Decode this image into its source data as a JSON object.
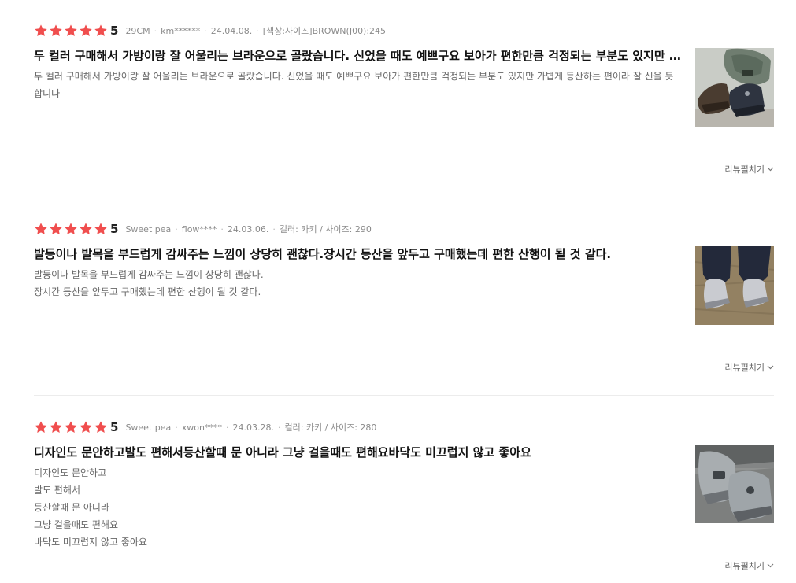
{
  "colors": {
    "star": "#f04e4e",
    "meta_text": "#8a8a8a",
    "title_text": "#111111",
    "body_text": "#666666",
    "divider": "#ececec"
  },
  "expand_icon": "chevron-down-icon",
  "reviews": [
    {
      "stars": 5,
      "rating": "5",
      "source": "29CM",
      "user": "km******",
      "date": "24.04.08.",
      "option": "[색상:사이즈]BROWN(J00):245",
      "title": "두 컬러 구매해서 가방이랑 잘 어울리는 브라운으로 골랐습니다. 신었을 때도 예쁘구요 보아가 편한만큼 걱정되는 부분도 있지만 가볍게 등산하는 편이라 잘 신을 듯 합니다",
      "body": [
        "두 컬러 구매해서 가방이랑 잘 어울리는 브라운으로 골랐습니다. 신었을 때도 예쁘구요 보아가 편한만큼 걱정되는 부분도 있지만 가볍게 등산하는 편이라 잘 신을 듯 합니다"
      ],
      "photo": "photo of brown hiking shoes next to a green backpack",
      "expand_label": "리뷰펼치기"
    },
    {
      "stars": 5,
      "rating": "5",
      "source": "Sweet pea",
      "user": "flow****",
      "date": "24.03.06.",
      "option": "컬러: 카키 / 사이즈: 290",
      "title": "발등이나 발목을 부드럽게 감싸주는 느낌이 상당히 괜찮다.장시간 등산을 앞두고 구매했는데 편한 산행이 될 것 같다.",
      "body": [
        "발등이나 발목을 부드럽게 감싸주는 느낌이 상당히 괜찮다.",
        "장시간 등산을 앞두고 구매했는데 편한 산행이 될 것 같다."
      ],
      "photo": "photo of light grey hiking shoes worn on dry grass",
      "expand_label": "리뷰펼치기"
    },
    {
      "stars": 5,
      "rating": "5",
      "source": "Sweet pea",
      "user": "xwon****",
      "date": "24.03.28.",
      "option": "컬러: 카키 / 사이즈: 280",
      "title": "디자인도 문안하고발도 편해서등산할때 문 아니라 그냥 걸을때도 편해요바닥도 미끄럽지 않고 좋아요",
      "body": [
        "디자인도 문안하고",
        "발도 편해서",
        "등산할때 문 아니라",
        "그냥 걸을때도 편해요",
        "바닥도 미끄럽지 않고 좋아요"
      ],
      "photo": "photo of grey hiking shoes on a floor",
      "expand_label": "리뷰펼치기"
    }
  ]
}
